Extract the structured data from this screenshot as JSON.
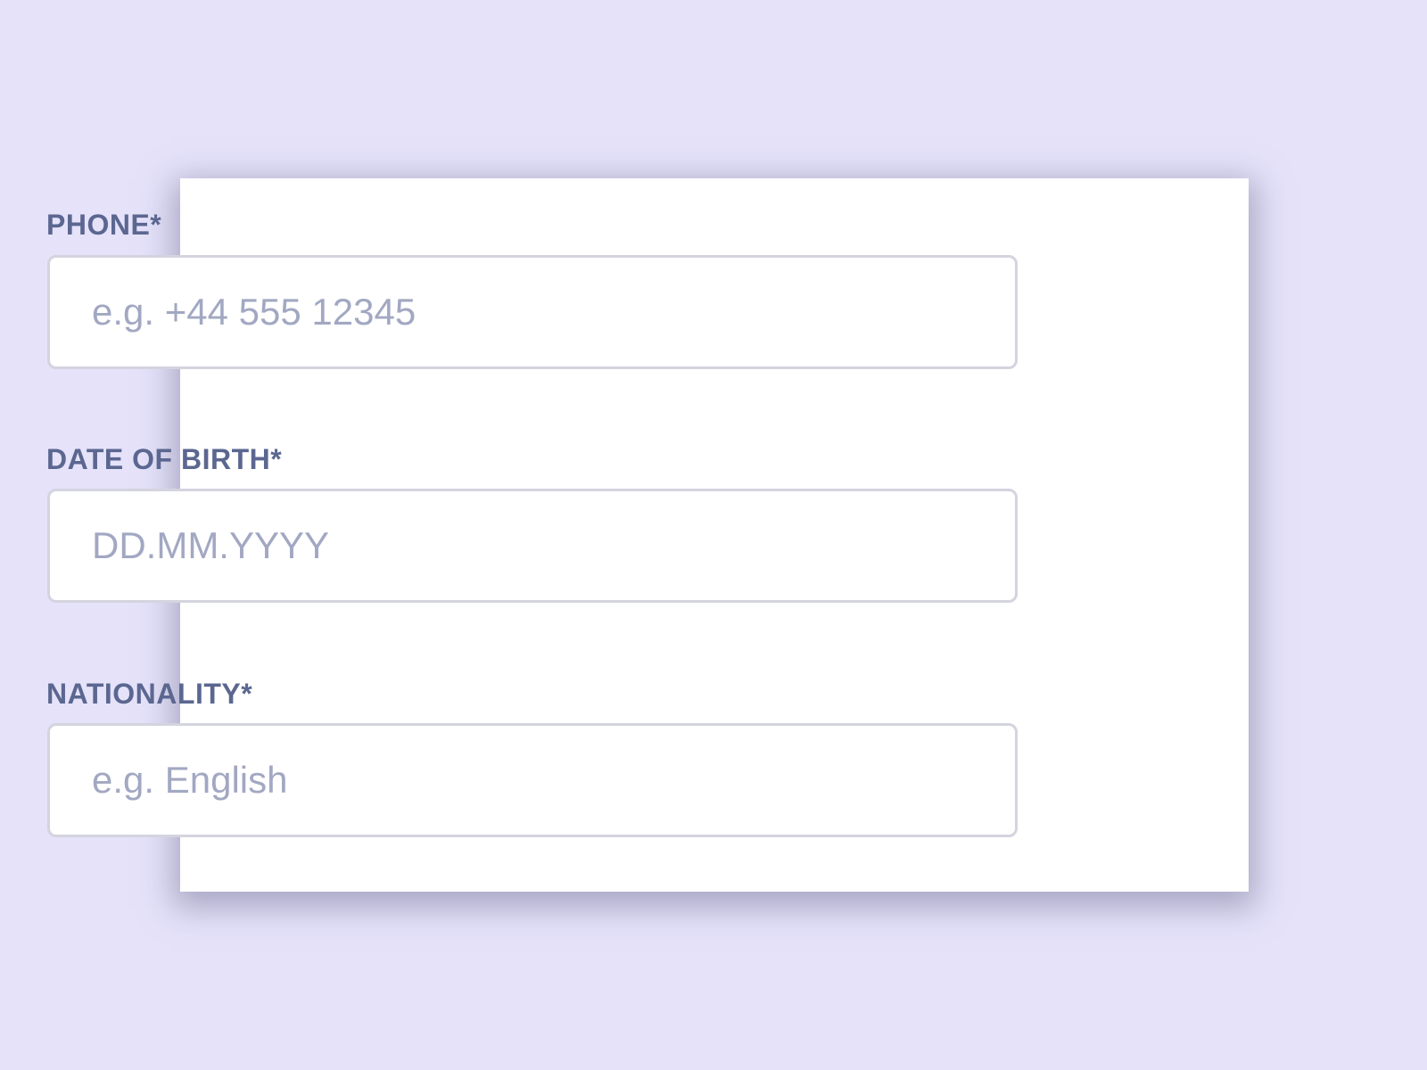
{
  "form": {
    "fields": [
      {
        "label": "PHONE*",
        "value": "",
        "placeholder": "e.g. +44 555 12345"
      },
      {
        "label": "DATE OF BIRTH*",
        "value": "",
        "placeholder": "DD.MM.YYYY"
      },
      {
        "label": "NATIONALITY*",
        "value": "",
        "placeholder": "e.g. English"
      }
    ]
  },
  "colors": {
    "background": "#e5e2fa",
    "card": "#ffffff",
    "label": "#5b6790",
    "placeholder": "#a2a8c2",
    "input_border": "#d4d4df"
  }
}
